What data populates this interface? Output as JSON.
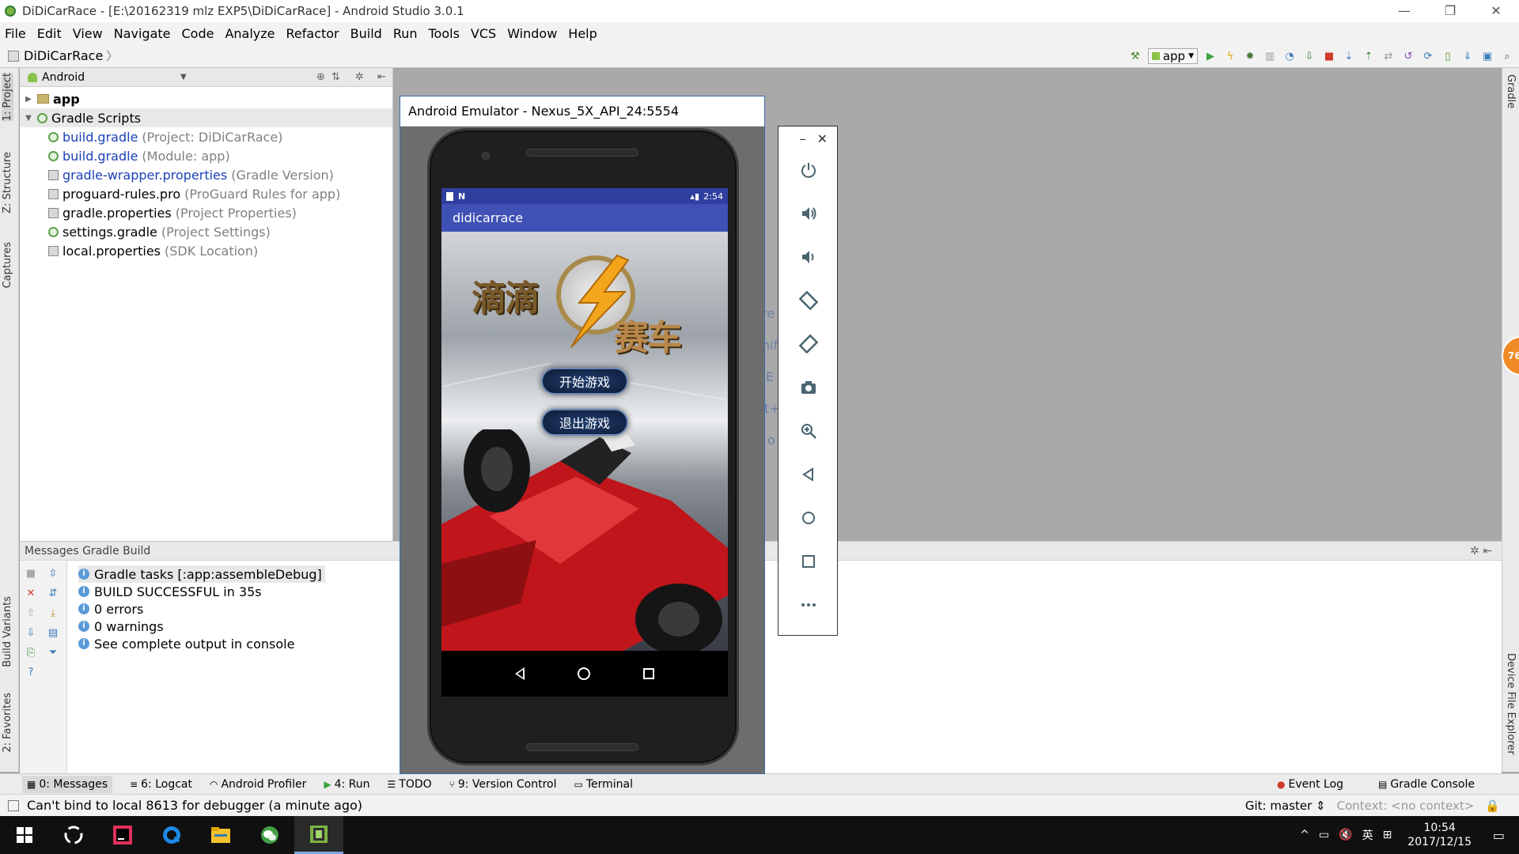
{
  "window": {
    "title": "DiDiCarRace - [E:\\20162319 mlz EXP5\\DiDiCarRace] - Android Studio 3.0.1",
    "controls": [
      "—",
      "❐",
      "✕"
    ]
  },
  "menu": [
    "File",
    "Edit",
    "View",
    "Navigate",
    "Code",
    "Analyze",
    "Refactor",
    "Build",
    "Run",
    "Tools",
    "VCS",
    "Window",
    "Help"
  ],
  "breadcrumb": {
    "project": "DiDiCarRace"
  },
  "toolbar": {
    "run_config": "app"
  },
  "left_tabs": [
    "1: Project",
    "Z: Structure",
    "Captures",
    "Build Variants",
    "2: Favorites"
  ],
  "right_tabs": [
    "Gradle",
    "Device File Explorer"
  ],
  "project_panel": {
    "view_mode": "Android",
    "tree": [
      {
        "name": "app",
        "hint": "",
        "kind": "folder",
        "style": "bold",
        "arrow": "▶"
      },
      {
        "name": "Gradle Scripts",
        "hint": "",
        "kind": "gradle",
        "style": "normal",
        "arrow": "▼",
        "selected": true
      },
      {
        "name": "build.gradle",
        "hint": "(Project: DiDiCarRace)",
        "kind": "gradle",
        "style": "blue"
      },
      {
        "name": "build.gradle",
        "hint": "(Module: app)",
        "kind": "gradle",
        "style": "blue"
      },
      {
        "name": "gradle-wrapper.properties",
        "hint": "(Gradle Version)",
        "kind": "props",
        "style": "blue"
      },
      {
        "name": "proguard-rules.pro",
        "hint": "(ProGuard Rules for app)",
        "kind": "props",
        "style": "normal"
      },
      {
        "name": "gradle.properties",
        "hint": "(Project Properties)",
        "kind": "props",
        "style": "normal"
      },
      {
        "name": "settings.gradle",
        "hint": "(Project Settings)",
        "kind": "gradle",
        "style": "normal"
      },
      {
        "name": "local.properties",
        "hint": "(SDK Location)",
        "kind": "props",
        "style": "normal"
      }
    ]
  },
  "editor_hint_fragments": [
    "re",
    "hift",
    "hif",
    "E",
    "t+",
    "o"
  ],
  "messages_panel": {
    "header": "Messages Gradle Build",
    "messages": [
      "Gradle tasks [:app:assembleDebug]",
      "BUILD SUCCESSFUL in 35s",
      "0 errors",
      "0 warnings",
      "See complete output in console"
    ]
  },
  "bottom_tabs": [
    {
      "label": "0: Messages",
      "icon": "▦",
      "active": true
    },
    {
      "label": "6: Logcat",
      "icon": "≡"
    },
    {
      "label": "Android Profiler",
      "icon": "◠"
    },
    {
      "label": "4: Run",
      "icon": "▶"
    },
    {
      "label": "TODO",
      "icon": "☰"
    },
    {
      "label": "9: Version Control",
      "icon": "⑂"
    },
    {
      "label": "Terminal",
      "icon": "▭"
    }
  ],
  "bottom_tabs_right": [
    {
      "label": "Event Log",
      "icon": "●"
    },
    {
      "label": "Gradle Console",
      "icon": "▤"
    }
  ],
  "status": {
    "message": "Can't bind to local 8613 for debugger (a minute ago)",
    "git": "Git: master",
    "context": "Context: <no context>"
  },
  "emulator": {
    "window_title": "Android Emulator - Nexus_5X_API_24:5554",
    "status_time": "2:54",
    "app_title": "didicarrace",
    "game_logo_left": "滴滴",
    "game_logo_right": "赛车",
    "start_button": "开始游戏",
    "exit_button": "退出游戏",
    "controls": [
      "power",
      "volume-up",
      "volume-down",
      "rotate-left",
      "rotate-right",
      "screenshot",
      "zoom",
      "back",
      "home",
      "overview",
      "more"
    ]
  },
  "badge": "76",
  "taskbar": {
    "time": "10:54",
    "date": "2017/12/15",
    "tray": [
      "^",
      "▭",
      "🔇",
      "英",
      "⊞"
    ]
  }
}
